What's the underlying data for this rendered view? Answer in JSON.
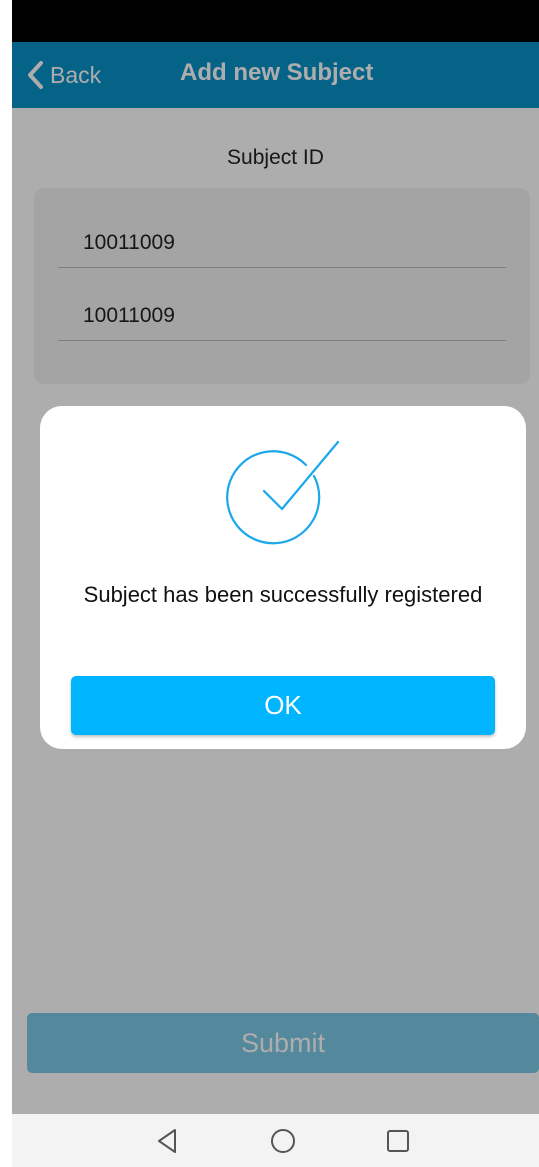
{
  "app_bar": {
    "back_label": "Back",
    "title": "Add new Subject",
    "color": "#0a93c9"
  },
  "form": {
    "heading": "Subject ID",
    "fields": [
      {
        "value": "10011009"
      },
      {
        "value": "10011009"
      }
    ],
    "submit_label": "Submit",
    "submit_color": "#7cc9e6"
  },
  "dialog": {
    "icon": "check-circle-icon",
    "message": "Subject has been successfully registered",
    "ok_label": "OK",
    "ok_color": "#00b4ff",
    "icon_color": "#1aa7ec"
  },
  "nav": {
    "icons": [
      "nav-back-icon",
      "nav-home-icon",
      "nav-recents-icon"
    ]
  }
}
